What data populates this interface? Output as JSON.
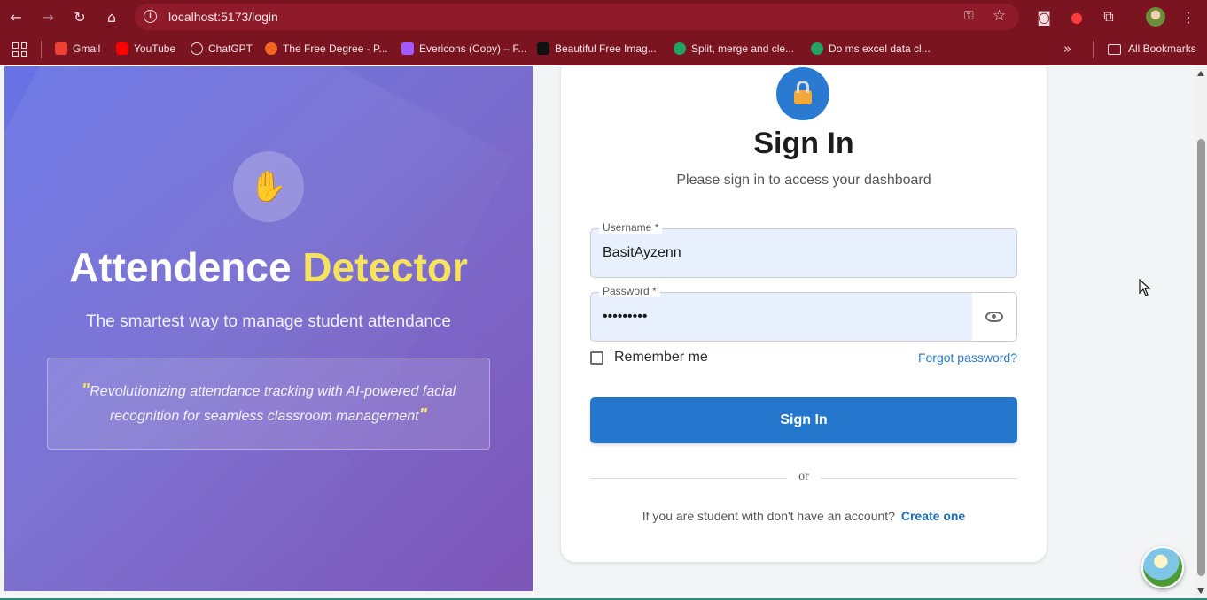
{
  "browser": {
    "url": "localhost:5173/login",
    "bookmarks": [
      {
        "label": "Gmail",
        "color": "#ea4335"
      },
      {
        "label": "YouTube",
        "color": "#ff0000"
      },
      {
        "label": "ChatGPT",
        "color": "#e8e8e8"
      },
      {
        "label": "The Free Degree - P...",
        "color": "#f26522"
      },
      {
        "label": "Evericons (Copy) – F...",
        "color": "#a259ff"
      },
      {
        "label": "Beautiful Free Imag...",
        "color": "#111111"
      },
      {
        "label": "Split, merge and cle...",
        "color": "#21a366"
      },
      {
        "label": "Do ms excel data cl...",
        "color": "#21a366"
      }
    ],
    "all_bookmarks": "All Bookmarks"
  },
  "hero": {
    "icon": "waving-hand-icon",
    "title_main": "Attendence",
    "title_accent": "Detector",
    "accent_color": "#f5e35f",
    "subtitle": "The smartest way to manage student attendance",
    "quote_open": "\"",
    "quote": "Revolutionizing attendance tracking with AI-powered facial recognition for seamless classroom management",
    "quote_close": "\""
  },
  "login": {
    "icon": "lock-icon",
    "title": "Sign In",
    "subtitle": "Please sign in to access your dashboard",
    "username_label": "Username *",
    "username_value": "BasitAyzenn",
    "password_label": "Password *",
    "password_value": "•••••••••",
    "remember_label": "Remember me",
    "forgot_label": "Forgot password?",
    "signin_button": "Sign In",
    "divider_text": "or",
    "signup_prompt": "If you are student with don't have an account?",
    "create_link": "Create one",
    "primary_color": "#2477cc"
  }
}
